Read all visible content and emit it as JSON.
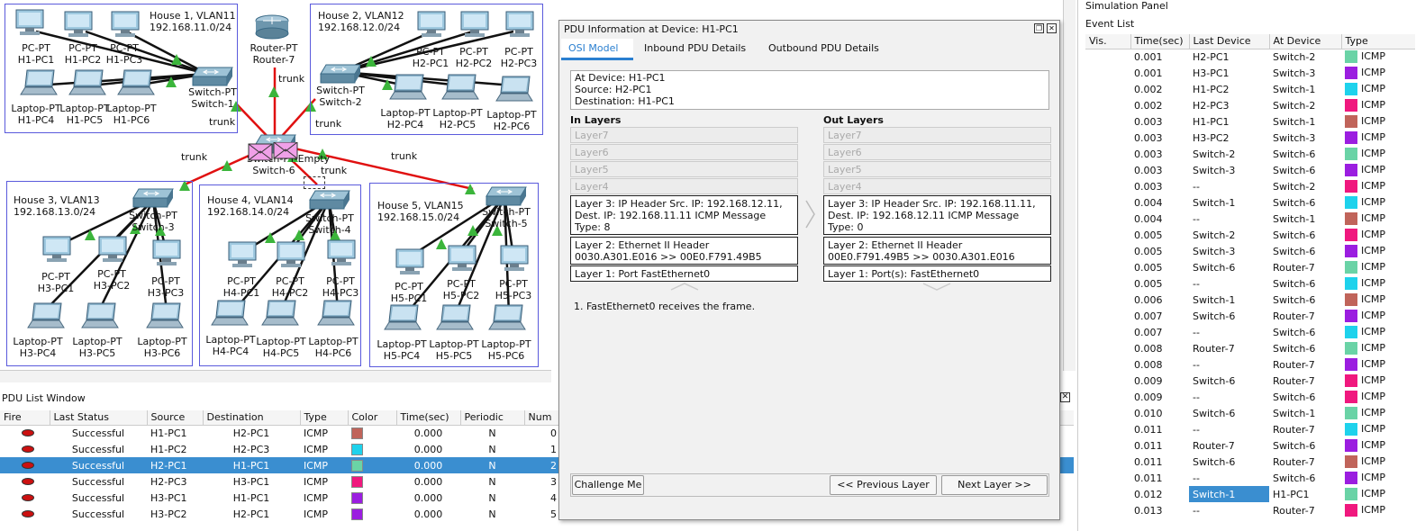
{
  "topology": {
    "houses": [
      {
        "title": "House 1, VLAN11\n192.168.11.0/24"
      },
      {
        "title": "House 2, VLAN12\n192.168.12.0/24"
      },
      {
        "title": "House 3, VLAN13\n192.168.13.0/24"
      },
      {
        "title": "House 4, VLAN14\n192.168.14.0/24"
      },
      {
        "title": "House 5, VLAN15\n192.168.15.0/24"
      }
    ],
    "devices": {
      "h1pc1": "PC-PT\nH1-PC1",
      "h1pc2": "PC-PT\nH1-PC2",
      "h1pc3": "PC-PT\nH1-PC3",
      "h1pc4": "Laptop-PT\nH1-PC4",
      "h1pc5": "Laptop-PT\nH1-PC5",
      "h1pc6": "Laptop-PT\nH1-PC6",
      "sw1": "Switch-PT\nSwitch-1",
      "router": "Router-PT\nRouter-7",
      "h2pc1": "PC-PT\nH2-PC1",
      "h2pc2": "PC-PT\nH2-PC2",
      "h2pc3": "PC-PT\nH2-PC3",
      "h2pc4": "Laptop-PT\nH2-PC4",
      "h2pc5": "Laptop-PT\nH2-PC5",
      "h2pc6": "Laptop-PT\nH2-PC6",
      "sw2": "Switch-PT\nSwitch-2",
      "sw6": "Switch-PT-Empty\nSwitch-6",
      "h3pc1": "PC-PT\nH3-PC1",
      "h3pc2": "PC-PT\nH3-PC2",
      "h3pc3": "PC-PT\nH3-PC3",
      "h3pc4": "Laptop-PT\nH3-PC4",
      "h3pc5": "Laptop-PT\nH3-PC5",
      "h3pc6": "Laptop-PT\nH3-PC6",
      "sw3": "Switch-PT\nSwitch-3",
      "h4pc1": "PC-PT\nH4-PC1",
      "h4pc2": "PC-PT\nH4-PC2",
      "h4pc3": "PC-PT\nH4-PC3",
      "h4pc4": "Laptop-PT\nH4-PC4",
      "h4pc5": "Laptop-PT\nH4-PC5",
      "h4pc6": "Laptop-PT\nH4-PC6",
      "sw4": "Switch-PT\nSwitch-4",
      "h5pc1": "PC-PT\nH5-PC1",
      "h5pc2": "PC-PT\nH5-PC2",
      "h5pc3": "PC-PT\nH5-PC3",
      "h5pc4": "Laptop-PT\nH5-PC4",
      "h5pc5": "Laptop-PT\nH5-PC5",
      "h5pc6": "Laptop-PT\nH5-PC6",
      "sw5": "Switch-PT\nSwitch-5"
    },
    "trunk_label": "trunk"
  },
  "pdu_list": {
    "title": "PDU List Window",
    "columns": [
      "Fire",
      "Last Status",
      "Source",
      "Destination",
      "Type",
      "Color",
      "Time(sec)",
      "Periodic",
      "Num"
    ],
    "rows": [
      {
        "status": "Successful",
        "source": "H1-PC1",
        "dest": "H2-PC1",
        "type": "ICMP",
        "color": "#c0645a",
        "time": "0.000",
        "periodic": "N",
        "num": "0"
      },
      {
        "status": "Successful",
        "source": "H1-PC2",
        "dest": "H2-PC3",
        "type": "ICMP",
        "color": "#1ed2ec",
        "time": "0.000",
        "periodic": "N",
        "num": "1"
      },
      {
        "status": "Successful",
        "source": "H2-PC1",
        "dest": "H1-PC1",
        "type": "ICMP",
        "color": "#6ad3a6",
        "time": "0.000",
        "periodic": "N",
        "num": "2"
      },
      {
        "status": "Successful",
        "source": "H2-PC3",
        "dest": "H3-PC1",
        "type": "ICMP",
        "color": "#f0187e",
        "time": "0.000",
        "periodic": "N",
        "num": "3"
      },
      {
        "status": "Successful",
        "source": "H3-PC1",
        "dest": "H1-PC1",
        "type": "ICMP",
        "color": "#9b1ee0",
        "time": "0.000",
        "periodic": "N",
        "num": "4"
      },
      {
        "status": "Successful",
        "source": "H3-PC2",
        "dest": "H2-PC1",
        "type": "ICMP",
        "color": "#9b1ee0",
        "time": "0.000",
        "periodic": "N",
        "num": "5"
      }
    ]
  },
  "dialog": {
    "title": "PDU Information at Device: H1-PC1",
    "tabs": [
      "OSI Model",
      "Inbound PDU Details",
      "Outbound PDU Details"
    ],
    "info": [
      "At Device: H1-PC1",
      "Source: H2-PC1",
      "Destination: H1-PC1"
    ],
    "in_header": "In Layers",
    "out_header": "Out Layers",
    "in_layers": {
      "l7": "Layer7",
      "l6": "Layer6",
      "l5": "Layer5",
      "l4": "Layer4",
      "l3": "Layer 3: IP Header Src. IP: 192.168.12.11, Dest. IP: 192.168.11.11 ICMP Message Type: 8",
      "l2": "Layer 2: Ethernet II Header 0030.A301.E016 >> 00E0.F791.49B5",
      "l1": "Layer 1: Port FastEthernet0"
    },
    "out_layers": {
      "l7": "Layer7",
      "l6": "Layer6",
      "l5": "Layer5",
      "l4": "Layer4",
      "l3": "Layer 3: IP Header Src. IP: 192.168.11.11, Dest. IP: 192.168.12.11 ICMP Message Type: 0",
      "l2": "Layer 2: Ethernet II Header 00E0.F791.49B5 >> 0030.A301.E016",
      "l1": "Layer 1: Port(s): FastEthernet0"
    },
    "description": "1. FastEthernet0 receives the frame.",
    "challenge": "Challenge Me",
    "prev": "<< Previous Layer",
    "next": "Next Layer >>"
  },
  "simulation": {
    "title": "Simulation Panel",
    "event_list": "Event List",
    "columns": [
      "Vis.",
      "Time(sec)",
      "Last Device",
      "At Device",
      "Type"
    ],
    "events": [
      {
        "time": "0.001",
        "last": "H2-PC1",
        "at": "Switch-2",
        "color": "#6ad3a6",
        "type": "ICMP"
      },
      {
        "time": "0.001",
        "last": "H3-PC1",
        "at": "Switch-3",
        "color": "#9b1ee0",
        "type": "ICMP"
      },
      {
        "time": "0.002",
        "last": "H1-PC2",
        "at": "Switch-1",
        "color": "#1ed2ec",
        "type": "ICMP"
      },
      {
        "time": "0.002",
        "last": "H2-PC3",
        "at": "Switch-2",
        "color": "#f0187e",
        "type": "ICMP"
      },
      {
        "time": "0.003",
        "last": "H1-PC1",
        "at": "Switch-1",
        "color": "#c0645a",
        "type": "ICMP"
      },
      {
        "time": "0.003",
        "last": "H3-PC2",
        "at": "Switch-3",
        "color": "#9b1ee0",
        "type": "ICMP"
      },
      {
        "time": "0.003",
        "last": "Switch-2",
        "at": "Switch-6",
        "color": "#6ad3a6",
        "type": "ICMP"
      },
      {
        "time": "0.003",
        "last": "Switch-3",
        "at": "Switch-6",
        "color": "#9b1ee0",
        "type": "ICMP"
      },
      {
        "time": "0.003",
        "last": "--",
        "at": "Switch-2",
        "color": "#f0187e",
        "type": "ICMP"
      },
      {
        "time": "0.004",
        "last": "Switch-1",
        "at": "Switch-6",
        "color": "#1ed2ec",
        "type": "ICMP"
      },
      {
        "time": "0.004",
        "last": "--",
        "at": "Switch-1",
        "color": "#c0645a",
        "type": "ICMP"
      },
      {
        "time": "0.005",
        "last": "Switch-2",
        "at": "Switch-6",
        "color": "#f0187e",
        "type": "ICMP"
      },
      {
        "time": "0.005",
        "last": "Switch-3",
        "at": "Switch-6",
        "color": "#9b1ee0",
        "type": "ICMP"
      },
      {
        "time": "0.005",
        "last": "Switch-6",
        "at": "Router-7",
        "color": "#6ad3a6",
        "type": "ICMP"
      },
      {
        "time": "0.005",
        "last": "--",
        "at": "Switch-6",
        "color": "#1ed2ec",
        "type": "ICMP"
      },
      {
        "time": "0.006",
        "last": "Switch-1",
        "at": "Switch-6",
        "color": "#c0645a",
        "type": "ICMP"
      },
      {
        "time": "0.007",
        "last": "Switch-6",
        "at": "Router-7",
        "color": "#9b1ee0",
        "type": "ICMP"
      },
      {
        "time": "0.007",
        "last": "--",
        "at": "Switch-6",
        "color": "#1ed2ec",
        "type": "ICMP"
      },
      {
        "time": "0.008",
        "last": "Router-7",
        "at": "Switch-6",
        "color": "#6ad3a6",
        "type": "ICMP"
      },
      {
        "time": "0.008",
        "last": "--",
        "at": "Router-7",
        "color": "#9b1ee0",
        "type": "ICMP"
      },
      {
        "time": "0.009",
        "last": "Switch-6",
        "at": "Router-7",
        "color": "#f0187e",
        "type": "ICMP"
      },
      {
        "time": "0.009",
        "last": "--",
        "at": "Switch-6",
        "color": "#f0187e",
        "type": "ICMP"
      },
      {
        "time": "0.010",
        "last": "Switch-6",
        "at": "Switch-1",
        "color": "#6ad3a6",
        "type": "ICMP"
      },
      {
        "time": "0.011",
        "last": "--",
        "at": "Router-7",
        "color": "#1ed2ec",
        "type": "ICMP"
      },
      {
        "time": "0.011",
        "last": "Router-7",
        "at": "Switch-6",
        "color": "#9b1ee0",
        "type": "ICMP"
      },
      {
        "time": "0.011",
        "last": "Switch-6",
        "at": "Router-7",
        "color": "#c0645a",
        "type": "ICMP"
      },
      {
        "time": "0.011",
        "last": "--",
        "at": "Switch-6",
        "color": "#9b1ee0",
        "type": "ICMP"
      },
      {
        "time": "0.012",
        "last": "Switch-1",
        "at": "H1-PC1",
        "color": "#6ad3a6",
        "type": "ICMP"
      },
      {
        "time": "0.013",
        "last": "--",
        "at": "Router-7",
        "color": "#f0187e",
        "type": "ICMP"
      }
    ]
  }
}
